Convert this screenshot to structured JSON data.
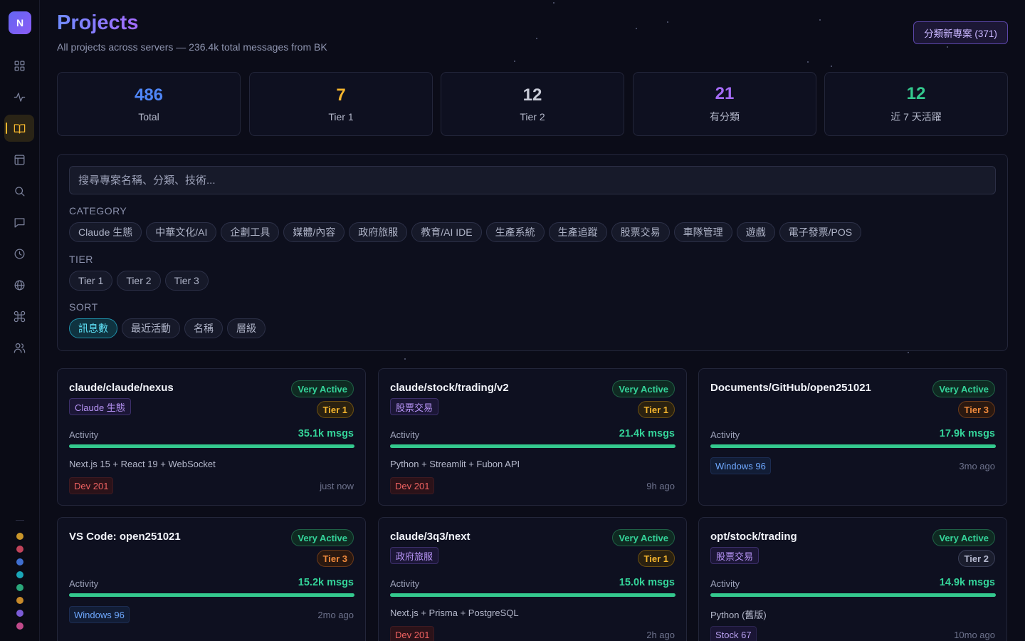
{
  "app": {
    "logo_letter": "N"
  },
  "sidebar": {
    "items": [
      {
        "icon": "grid-icon",
        "active": false
      },
      {
        "icon": "activity-icon",
        "active": false
      },
      {
        "icon": "book-icon",
        "active": true
      },
      {
        "icon": "layout-icon",
        "active": false
      },
      {
        "icon": "search-icon",
        "active": false
      },
      {
        "icon": "message-icon",
        "active": false
      },
      {
        "icon": "clock-icon",
        "active": false
      },
      {
        "icon": "globe-icon",
        "active": false
      },
      {
        "icon": "command-icon",
        "active": false
      },
      {
        "icon": "users-icon",
        "active": false
      }
    ],
    "dot_colors": [
      "#c9962a",
      "#c0435a",
      "#3f6fd0",
      "#1aa6b7",
      "#2aa77a",
      "#c78a2a",
      "#7b5cd6",
      "#c04a8a"
    ]
  },
  "header": {
    "title": "Projects",
    "subtitle": "All projects across servers — 236.4k total messages from BK",
    "classify_button": "分類新專案 (371)"
  },
  "stats": [
    {
      "value": "486",
      "label": "Total",
      "color": "#4f86f7"
    },
    {
      "value": "7",
      "label": "Tier 1",
      "color": "#f5b62e"
    },
    {
      "value": "12",
      "label": "Tier 2",
      "color": "#c9ccd8"
    },
    {
      "value": "21",
      "label": "有分類",
      "color": "#a56bf5"
    },
    {
      "value": "12",
      "label": "近 7 天活躍",
      "color": "#34c98e"
    }
  ],
  "filters": {
    "search_placeholder": "搜尋專案名稱、分類、技術...",
    "category_label": "CATEGORY",
    "categories": [
      "Claude 生態",
      "中華文化/AI",
      "企劃工具",
      "媒體/內容",
      "政府旅服",
      "教育/AI IDE",
      "生產系統",
      "生產追蹤",
      "股票交易",
      "車隊管理",
      "遊戲",
      "電子發票/POS"
    ],
    "tier_label": "TIER",
    "tiers": [
      "Tier 1",
      "Tier 2",
      "Tier 3"
    ],
    "sort_label": "SORT",
    "sorts": [
      "訊息數",
      "最近活動",
      "名稱",
      "層級"
    ],
    "selected_sort": "訊息數"
  },
  "projects": [
    {
      "name": "claude/claude/nexus",
      "status": "Very Active",
      "tier": "Tier 1",
      "category": "Claude 生態",
      "activity_label": "Activity",
      "messages": "35.1k msgs",
      "activity_pct": 100,
      "tech": "Next.js 15 + React 19 + WebSocket",
      "server": "Dev 201",
      "time": "just now"
    },
    {
      "name": "claude/stock/trading/v2",
      "status": "Very Active",
      "tier": "Tier 1",
      "category": "股票交易",
      "activity_label": "Activity",
      "messages": "21.4k msgs",
      "activity_pct": 100,
      "tech": "Python + Streamlit + Fubon API",
      "server": "Dev 201",
      "time": "9h ago"
    },
    {
      "name": "Documents/GitHub/open251021",
      "status": "Very Active",
      "tier": "Tier 3",
      "category": "",
      "activity_label": "Activity",
      "messages": "17.9k msgs",
      "activity_pct": 100,
      "tech": "",
      "server": "Windows 96",
      "time": "3mo ago"
    },
    {
      "name": "VS Code: open251021",
      "status": "Very Active",
      "tier": "Tier 3",
      "category": "",
      "activity_label": "Activity",
      "messages": "15.2k msgs",
      "activity_pct": 100,
      "tech": "",
      "server": "Windows 96",
      "time": "2mo ago"
    },
    {
      "name": "claude/3q3/next",
      "status": "Very Active",
      "tier": "Tier 1",
      "category": "政府旅服",
      "activity_label": "Activity",
      "messages": "15.0k msgs",
      "activity_pct": 100,
      "tech": "Next.js + Prisma + PostgreSQL",
      "server": "Dev 201",
      "time": "2h ago"
    },
    {
      "name": "opt/stock/trading",
      "status": "Very Active",
      "tier": "Tier 2",
      "category": "股票交易",
      "activity_label": "Activity",
      "messages": "14.9k msgs",
      "activity_pct": 100,
      "tech": "Python (舊版)",
      "server": "Stock 67",
      "time": "10mo ago"
    }
  ]
}
